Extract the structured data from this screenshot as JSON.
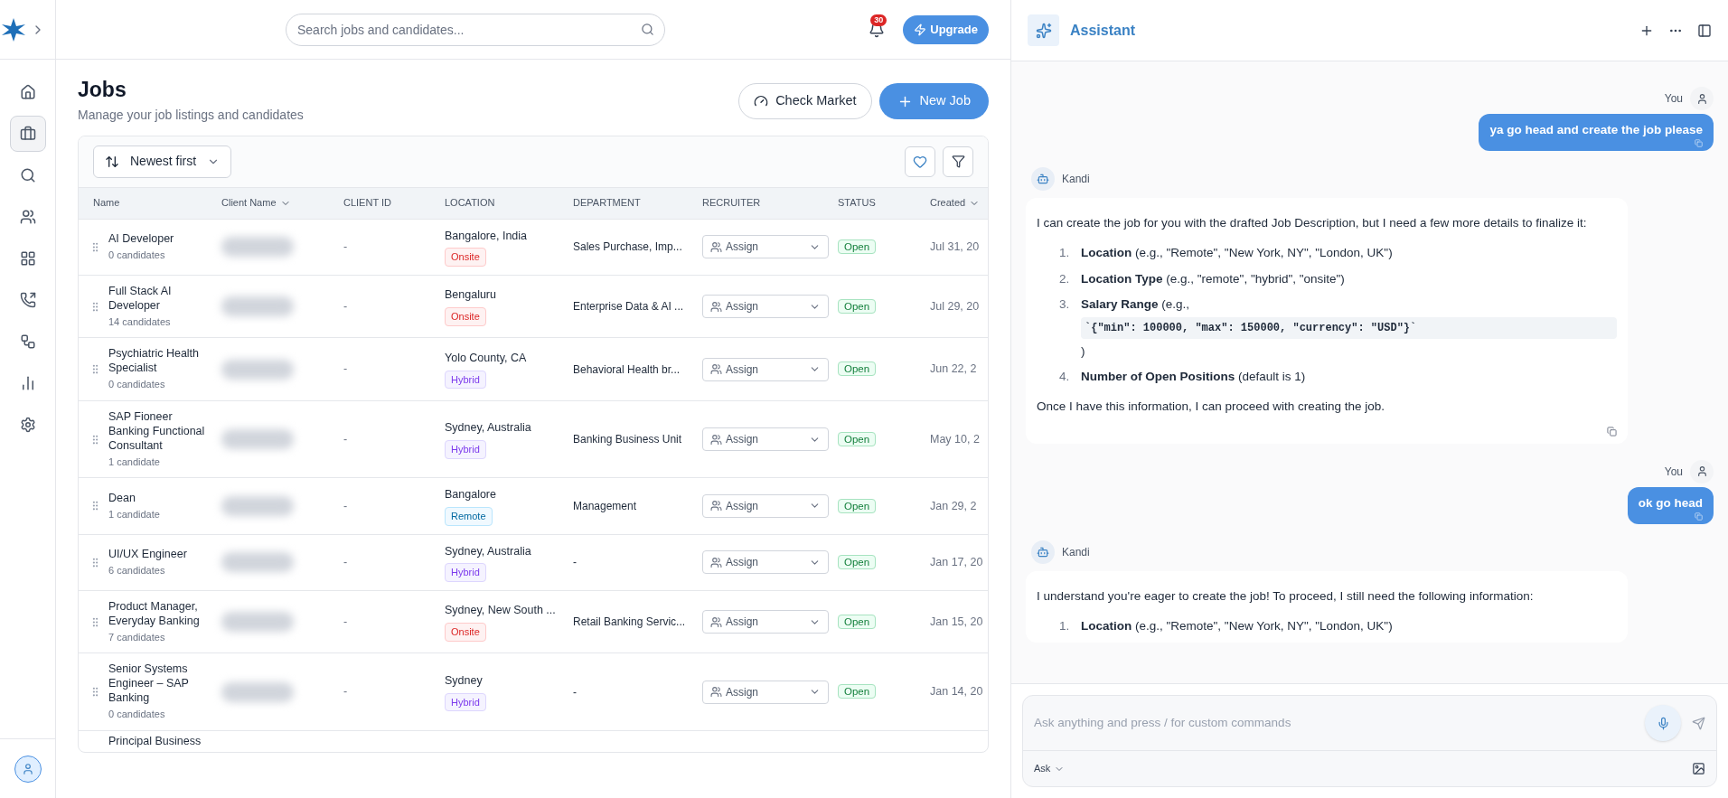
{
  "sidebar": {
    "items": [
      {
        "selected": false
      },
      {
        "selected": true
      },
      {
        "selected": false
      },
      {
        "selected": false
      },
      {
        "selected": false
      },
      {
        "selected": false
      },
      {
        "selected": false
      },
      {
        "selected": false
      },
      {
        "selected": false
      }
    ]
  },
  "topbar": {
    "search": {
      "placeholder": "Search jobs and candidates..."
    },
    "notifications": "30",
    "upgrade": "Upgrade"
  },
  "page": {
    "title": "Jobs",
    "subtitle": "Manage your job listings and candidates",
    "check_market": "Check Market",
    "new_job": "New Job"
  },
  "table": {
    "sort": "Newest first",
    "columns": [
      {
        "label": "Name",
        "kind": "plain"
      },
      {
        "label": "Client Name",
        "kind": "sortable"
      },
      {
        "label": "CLIENT ID",
        "kind": "plain"
      },
      {
        "label": "LOCATION",
        "kind": "plain"
      },
      {
        "label": "DEPARTMENT",
        "kind": "plain"
      },
      {
        "label": "RECRUITER",
        "kind": "plain"
      },
      {
        "label": "STATUS",
        "kind": "plain"
      },
      {
        "label": "Created",
        "kind": "sortable"
      }
    ],
    "rows": [
      {
        "name": "AI Developer",
        "candidates": "0 candidates",
        "client_id": "-",
        "location": "Bangalore, India",
        "location_type": {
          "label": "Onsite",
          "kind": "onsite"
        },
        "department": "Sales Purchase, Imp...",
        "recruiter": "Assign",
        "status": "Open",
        "created": "Jul 31, 20"
      },
      {
        "name": "Full Stack AI Developer",
        "candidates": "14 candidates",
        "client_id": "-",
        "location": "Bengaluru",
        "location_type": {
          "label": "Onsite",
          "kind": "onsite"
        },
        "department": "Enterprise Data & AI ...",
        "recruiter": "Assign",
        "status": "Open",
        "created": "Jul 29, 20"
      },
      {
        "name": "Psychiatric Health Specialist",
        "candidates": "0 candidates",
        "client_id": "-",
        "location": "Yolo County, CA",
        "location_type": {
          "label": "Hybrid",
          "kind": "hybrid"
        },
        "department": "Behavioral Health br...",
        "recruiter": "Assign",
        "status": "Open",
        "created": "Jun 22, 2"
      },
      {
        "name": "SAP Fioneer Banking Functional Consultant",
        "candidates": "1 candidate",
        "client_id": "-",
        "location": "Sydney, Australia",
        "location_type": {
          "label": "Hybrid",
          "kind": "hybrid"
        },
        "department": "Banking Business Unit",
        "recruiter": "Assign",
        "status": "Open",
        "created": "May 10, 2"
      },
      {
        "name": "Dean",
        "candidates": "1 candidate",
        "client_id": "-",
        "location": "Bangalore",
        "location_type": {
          "label": "Remote",
          "kind": "remote"
        },
        "department": "Management",
        "recruiter": "Assign",
        "status": "Open",
        "created": "Jan 29, 2"
      },
      {
        "name": "UI/UX Engineer",
        "candidates": "6 candidates",
        "client_id": "-",
        "location": "Sydney, Australia",
        "location_type": {
          "label": "Hybrid",
          "kind": "hybrid"
        },
        "department": "-",
        "recruiter": "Assign",
        "status": "Open",
        "created": "Jan 17, 20"
      },
      {
        "name": "Product Manager, Everyday Banking",
        "candidates": "7 candidates",
        "client_id": "-",
        "location": "Sydney, New South ...",
        "location_type": {
          "label": "Onsite",
          "kind": "onsite"
        },
        "department": "Retail Banking Servic...",
        "recruiter": "Assign",
        "status": "Open",
        "created": "Jan 15, 20"
      },
      {
        "name": "Senior Systems Engineer – SAP Banking",
        "candidates": "0 candidates",
        "client_id": "-",
        "location": "Sydney",
        "location_type": {
          "label": "Hybrid",
          "kind": "hybrid"
        },
        "department": "-",
        "recruiter": "Assign",
        "status": "Open",
        "created": "Jan 14, 20"
      },
      {
        "name": "Principal Business"
      }
    ]
  },
  "assistant": {
    "title": "Assistant",
    "input": {
      "placeholder": "Ask anything and press / for custom commands"
    },
    "mode": "Ask",
    "messages": [
      {
        "kind": "user",
        "author": "You",
        "text": "ya go head and create the job please"
      },
      {
        "kind": "bot",
        "author": "Kandi",
        "intro": "I can create the job for you with the drafted Job Description, but I need a few more details to finalize it:",
        "items": [
          {
            "number": "1.",
            "text": "**Location** (e.g., \"Remote\", \"New York, NY\", \"London, UK\")"
          },
          {
            "number": "2.",
            "text": "**Location Type** (e.g., \"remote\", \"hybrid\", \"onsite\")"
          },
          {
            "number": "3.",
            "text": "**Salary Range** (e.g.,",
            "code": "`{\"min\": 100000, \"max\": 150000, \"currency\": \"USD\"}`",
            "after": ")"
          },
          {
            "number": "4.",
            "text": "**Number of Open Positions** (default is 1)"
          }
        ],
        "outro": "Once I have this information, I can proceed with creating the job."
      },
      {
        "kind": "user",
        "author": "You",
        "text": "ok go head"
      },
      {
        "kind": "bot",
        "author": "Kandi",
        "intro": "I understand you're eager to create the job! To proceed, I still need the following information:",
        "items": [
          {
            "number": "1.",
            "text": "**Location** (e.g., \"Remote\", \"New York, NY\", \"London, UK\")"
          }
        ]
      }
    ]
  }
}
